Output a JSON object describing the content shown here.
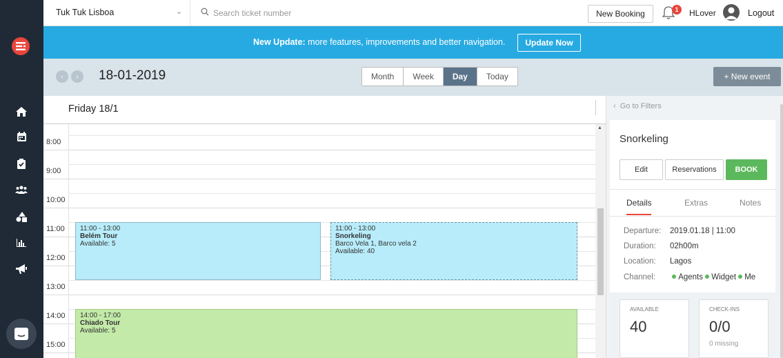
{
  "topbar": {
    "company": "Tuk Tuk Lisboa",
    "search_placeholder": "Search ticket number",
    "new_booking": "New Booking",
    "notification_count": "1",
    "username": "HLover",
    "logout": "Logout"
  },
  "sidebar": {
    "items": [
      {
        "icon": "home-icon"
      },
      {
        "icon": "calendar-icon"
      },
      {
        "icon": "clipboard-check-icon"
      },
      {
        "icon": "users-icon"
      },
      {
        "icon": "shapes-icon"
      },
      {
        "icon": "bar-chart-icon"
      },
      {
        "icon": "megaphone-icon"
      }
    ]
  },
  "banner": {
    "title": "New Update:",
    "message": " more features, improvements and better navigation.",
    "button": "Update Now"
  },
  "toolbar": {
    "date": "18-01-2019",
    "views": [
      "Month",
      "Week",
      "Day",
      "Today"
    ],
    "active_view": "Day",
    "new_event": "+ New event"
  },
  "calendar": {
    "day_header": "Friday 18/1",
    "hours": [
      "8:00",
      "9:00",
      "10:00",
      "11:00",
      "12:00",
      "13:00",
      "14:00",
      "15:00"
    ],
    "events": [
      {
        "time": "11:00 - 13:00",
        "title": "Belém Tour",
        "line1": "Available: 5",
        "line2": ""
      },
      {
        "time": "11:00 - 13:00",
        "title": "Snorkeling",
        "line1": "Barco Vela 1, Barco vela 2",
        "line2": "Available: 40"
      },
      {
        "time": "14:00 - 17:00",
        "title": "Chiado Tour",
        "line1": "Available: 5",
        "line2": ""
      }
    ]
  },
  "panel": {
    "go_to_filters": "Go to Filters",
    "title": "Snorkeling",
    "edit": "Edit",
    "reservations": "Reservations",
    "book": "BOOK",
    "tabs": [
      "Details",
      "Extras",
      "Notes"
    ],
    "details": {
      "departure_label": "Departure:",
      "departure_value": "2019.01.18 | 11:00",
      "duration_label": "Duration:",
      "duration_value": "02h00m",
      "location_label": "Location:",
      "location_value": "Lagos",
      "channel_label": "Channel:",
      "channels": [
        "Agents",
        "Widget",
        "Me"
      ]
    },
    "stats": {
      "available_label": "AVAILABLE",
      "available_value": "40",
      "checkins_label": "CHECK-INS",
      "checkins_value": "0/0",
      "checkins_sub": "0 missing"
    }
  },
  "colors": {
    "sidebar": "#1f2a36",
    "banner": "#27aae1",
    "event_blue": "#b8ecfa",
    "event_green": "#c3eaa8",
    "book_green": "#5cb85c",
    "accent_red": "#e8453c"
  }
}
